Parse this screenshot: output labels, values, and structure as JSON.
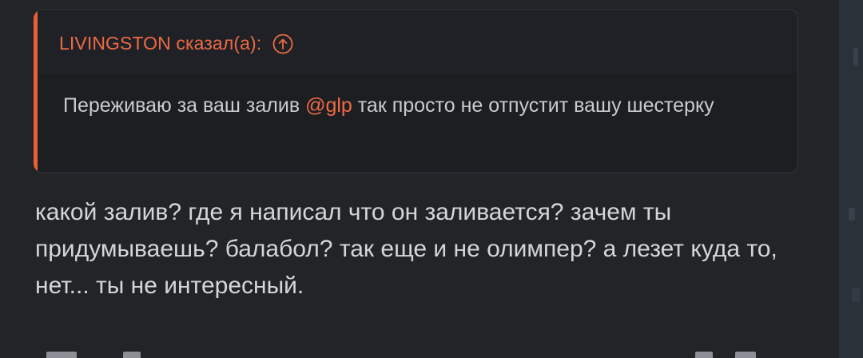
{
  "quote": {
    "author": "LIVINGSTON сказал(а):",
    "text_before": "Переживаю за ваш залив ",
    "mention": "@glp",
    "text_after": " так просто не отпустит вашу шестерку",
    "icon": "arrow-up-circle-icon",
    "accent_color": "#e85f3a"
  },
  "message": {
    "text": "какой залив? где я написал что он заливается? зачем ты придумываешь? балабол? так еще и не олимпер? а лезет куда то, нет... ты не интересный."
  }
}
